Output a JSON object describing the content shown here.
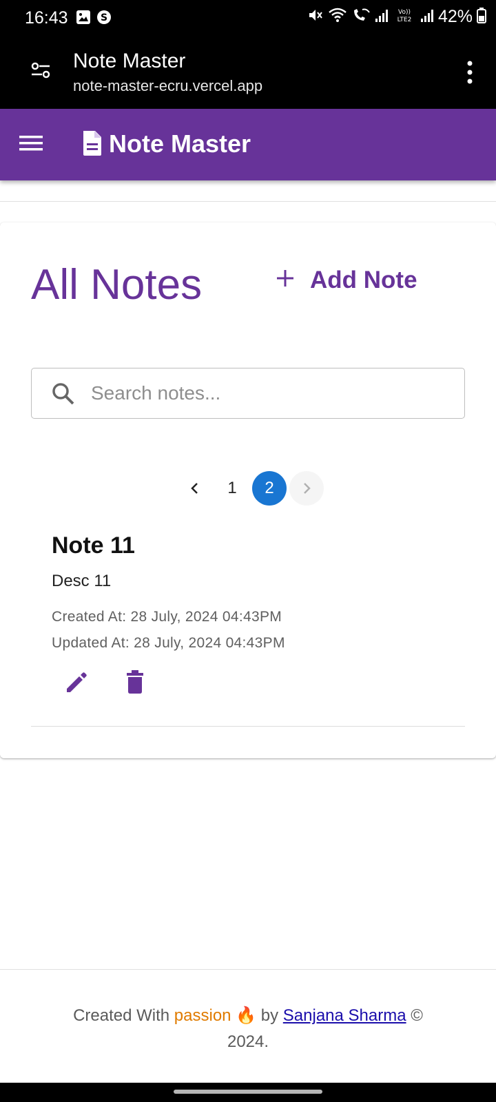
{
  "status_bar": {
    "time": "16:43",
    "battery": "42%",
    "icons": [
      "image-icon",
      "shazam-icon",
      "mute-icon",
      "wifi-icon",
      "wifi-calling-icon",
      "signal-icon",
      "volte-icon",
      "signal-icon",
      "battery-icon"
    ]
  },
  "browser_bar": {
    "title": "Note Master",
    "url": "note-master-ecru.vercel.app"
  },
  "app_bar": {
    "title": "Note Master",
    "color": "#673399"
  },
  "main": {
    "heading": "All Notes",
    "add_note_label": "Add Note",
    "search": {
      "placeholder": "Search notes...",
      "value": ""
    },
    "pagination": {
      "pages": [
        "1",
        "2"
      ],
      "current": "2",
      "active_color": "#1976d2"
    },
    "notes": [
      {
        "title": "Note 11",
        "description": "Desc 11",
        "created": "Created At: 28 July, 2024 04:43PM",
        "updated": "Updated At: 28 July, 2024 04:43PM"
      }
    ]
  },
  "footer": {
    "prefix": "Created With",
    "passion": "passion",
    "emoji": "🔥",
    "by": "by",
    "author": "Sanjana Sharma",
    "copyright": "©",
    "year": "2024."
  }
}
